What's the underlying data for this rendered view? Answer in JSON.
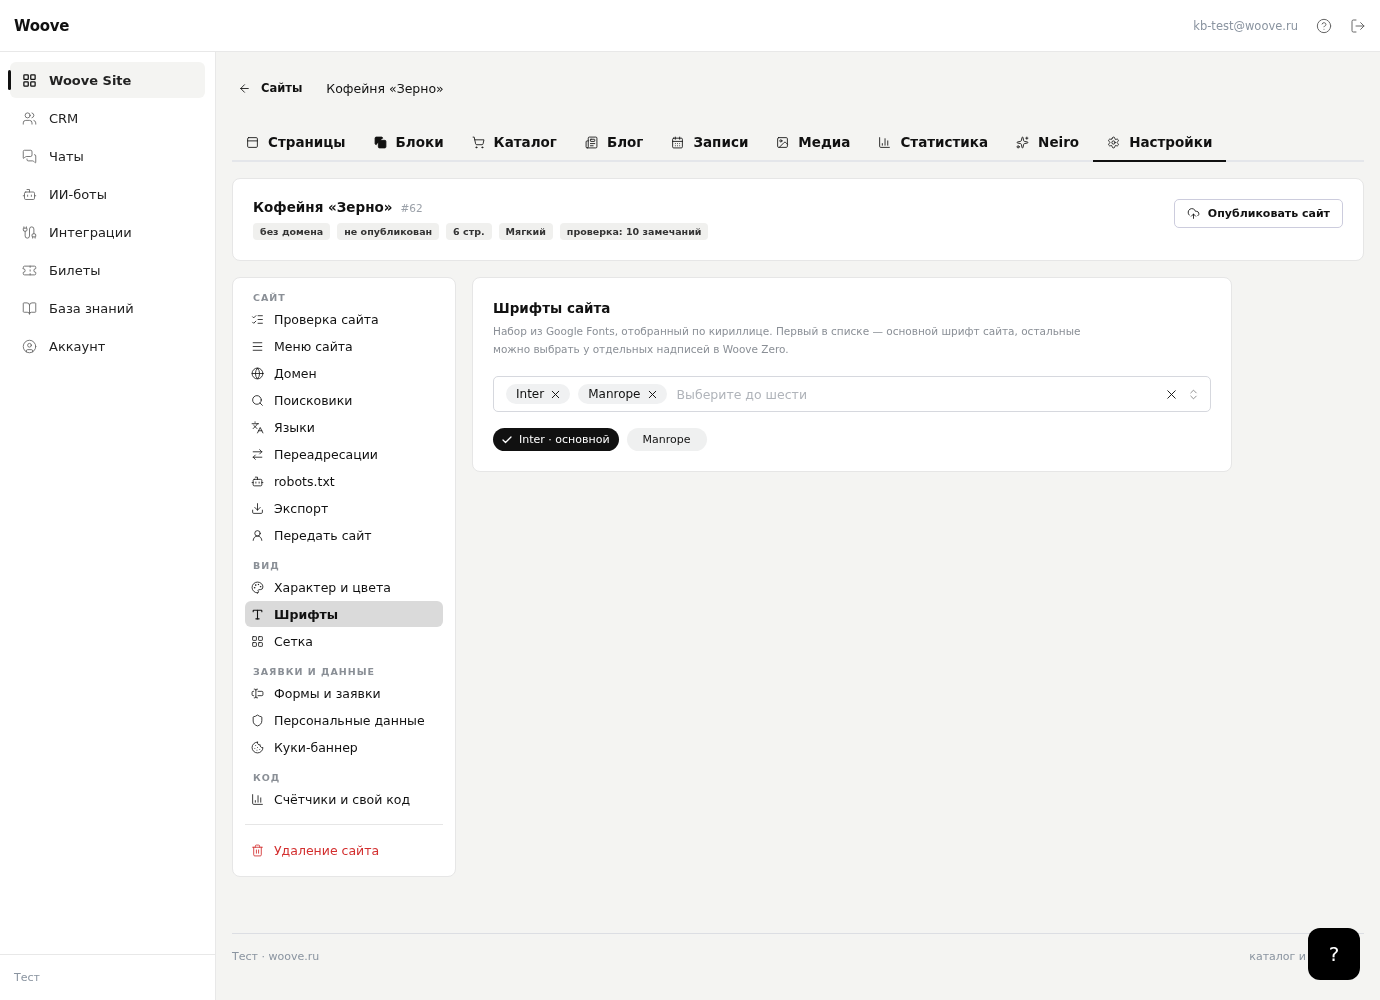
{
  "app": {
    "logo": "Woove",
    "user_email": "kb-test@woove.ru"
  },
  "sidebar": {
    "items": [
      {
        "label": "Woove Site",
        "selected": true
      },
      {
        "label": "CRM",
        "selected": false
      },
      {
        "label": "Чаты",
        "selected": false
      },
      {
        "label": "ИИ-боты",
        "selected": false
      },
      {
        "label": "Интеграции",
        "selected": false
      },
      {
        "label": "Билеты",
        "selected": false
      },
      {
        "label": "База знаний",
        "selected": false
      },
      {
        "label": "Аккаунт",
        "selected": false
      }
    ],
    "footer": "Тест"
  },
  "breadcrumb": {
    "back": "Сайты",
    "current": "Кофейня «Зерно»"
  },
  "tabs": [
    {
      "label": "Страницы",
      "selected": false
    },
    {
      "label": "Блоки",
      "selected": false
    },
    {
      "label": "Каталог",
      "selected": false
    },
    {
      "label": "Блог",
      "selected": false
    },
    {
      "label": "Записи",
      "selected": false
    },
    {
      "label": "Медиа",
      "selected": false
    },
    {
      "label": "Статистика",
      "selected": false
    },
    {
      "label": "Neiro",
      "selected": false
    },
    {
      "label": "Настройки",
      "selected": true
    }
  ],
  "site": {
    "title": "Кофейня «Зерно»",
    "id": "#62",
    "tags": [
      "без домена",
      "не опубликован",
      "6 стр.",
      "Мягкий",
      "проверка: 10 замечаний"
    ],
    "publish_button": "Опубликовать сайт"
  },
  "settings_nav": {
    "sections": [
      {
        "title": "САЙТ",
        "items": [
          {
            "label": "Проверка сайта",
            "selected": false
          },
          {
            "label": "Меню сайта",
            "selected": false
          },
          {
            "label": "Домен",
            "selected": false
          },
          {
            "label": "Поисковики",
            "selected": false
          },
          {
            "label": "Языки",
            "selected": false
          },
          {
            "label": "Переадресации",
            "selected": false
          },
          {
            "label": "robots.txt",
            "selected": false
          },
          {
            "label": "Экспорт",
            "selected": false
          },
          {
            "label": "Передать сайт",
            "selected": false
          }
        ]
      },
      {
        "title": "ВИД",
        "items": [
          {
            "label": "Характер и цвета",
            "selected": false
          },
          {
            "label": "Шрифты",
            "selected": true
          },
          {
            "label": "Сетка",
            "selected": false
          }
        ]
      },
      {
        "title": "ЗАЯВКИ И ДАННЫЕ",
        "items": [
          {
            "label": "Формы и заявки",
            "selected": false
          },
          {
            "label": "Персональные данные",
            "selected": false
          },
          {
            "label": "Куки-баннер",
            "selected": false
          }
        ]
      },
      {
        "title": "КОД",
        "items": [
          {
            "label": "Счётчики и свой код",
            "selected": false
          }
        ]
      }
    ],
    "danger_item": "Удаление сайта"
  },
  "fonts": {
    "title": "Шрифты сайта",
    "description": "Набор из Google Fonts, отобранный по кириллице. Первый в списке — основной шрифт сайта, остальные можно выбрать у отдельных надписей в Woove Zero.",
    "chosen": [
      "Inter",
      "Manrope"
    ],
    "placeholder": "Выберите до шести",
    "primary_options": [
      {
        "label": "Inter · основной",
        "selected": true
      },
      {
        "label": "Manrope",
        "selected": false
      }
    ]
  },
  "footer": {
    "left": "Тест · woove.ru",
    "right": "каталог и"
  },
  "help_button": "?"
}
